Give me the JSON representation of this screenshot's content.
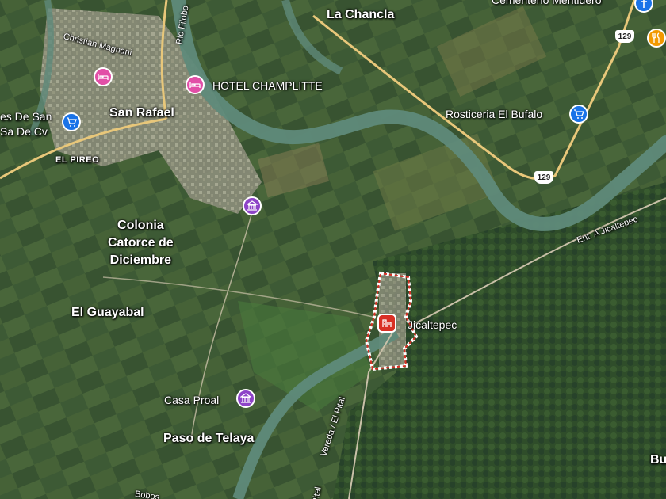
{
  "places": {
    "la_chancla": "La Chancla",
    "san_rafael": "San Rafael",
    "colonia_catorce": [
      "Colonia",
      "Catorce de",
      "Diciembre"
    ],
    "el_guayabal": "El Guayabal",
    "paso_de_telaya": "Paso de Telaya",
    "jicaltepec": "Jicaltepec",
    "el_pireo": "EL PIREO",
    "cementerio": "Cementerio Mentidero",
    "bu": "Bu"
  },
  "streets": {
    "christian_magnani": "Christian Magnani",
    "rio_filobo": "Rio Filobo",
    "ent_jicaltepec": "Ent. A Jicaltepec",
    "vereda_el_pital": "Vereda / El Pital",
    "pital": "Pital",
    "bobos": "Bobos"
  },
  "pois": {
    "hotel_champlitte": "HOTEL CHAMPLITTE",
    "rosticeria": "Rosticeria El Bufalo",
    "casa_proal": "Casa Proal",
    "left_store": [
      "es De San",
      "Sa De Cv"
    ]
  },
  "routes": {
    "r129_top": "129",
    "r129_mid": "129"
  },
  "colors": {
    "hotel_pin": "#e24fa7",
    "shop_pin": "#1a73e8",
    "museum_pin": "#8e44c8",
    "jicaltepec_pin": "#d93025",
    "food_pin": "#f29900",
    "river": "#5f8a7a",
    "road": "#e8c77a"
  }
}
